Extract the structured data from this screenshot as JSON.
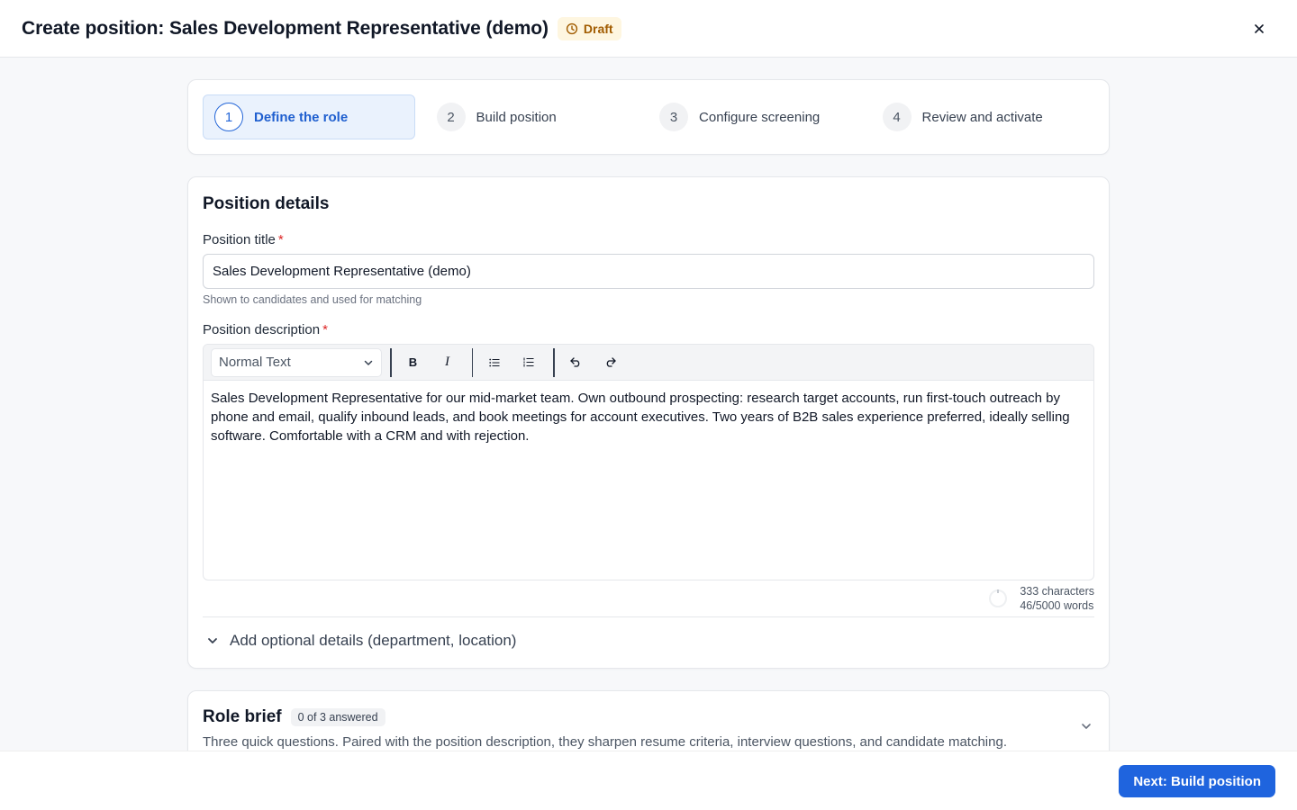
{
  "header": {
    "title": "Create position: Sales Development Representative (demo)",
    "status_badge": "Draft"
  },
  "stepper": {
    "steps": [
      {
        "num": "1",
        "label": "Define the role",
        "active": true
      },
      {
        "num": "2",
        "label": "Build position",
        "active": false
      },
      {
        "num": "3",
        "label": "Configure screening",
        "active": false
      },
      {
        "num": "4",
        "label": "Review and activate",
        "active": false
      }
    ]
  },
  "position_details": {
    "heading": "Position details",
    "title_label": "Position title",
    "required_mark": "*",
    "title_value": "Sales Development Representative (demo)",
    "title_hint": "Shown to candidates and used for matching",
    "description_label": "Position description",
    "format_select": "Normal Text",
    "toolbar": {
      "bold": "B",
      "italic": "I"
    },
    "description_text": "Sales Development Representative for our mid-market team. Own outbound prospecting: research target accounts, run first-touch outreach by phone and email, qualify inbound leads, and book meetings for account executives. Two years of B2B sales experience preferred, ideally selling software. Comfortable with a CRM and with rejection.",
    "char_count": "333 characters",
    "word_count": "46/5000 words",
    "optional_details": "Add optional details (department, location)"
  },
  "role_brief": {
    "heading": "Role brief",
    "answered": "0 of 3 answered",
    "description": "Three quick questions. Paired with the position description, they sharpen resume criteria, interview questions, and candidate matching."
  },
  "footer": {
    "next_label": "Next: Build position"
  },
  "colors": {
    "accent": "#1f64de",
    "draft_bg": "#fef6e0",
    "draft_text": "#a15c00",
    "required": "#dc2626"
  }
}
